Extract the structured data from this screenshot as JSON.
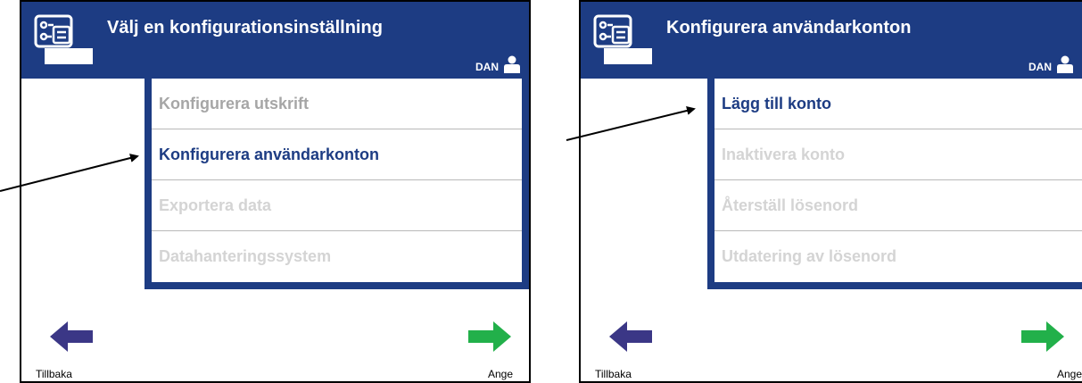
{
  "screens": [
    {
      "title": "Välj en konfigurationsinställning",
      "user": "DAN",
      "items": [
        {
          "label": "Konfigurera utskrift"
        },
        {
          "label": "Konfigurera användarkonton"
        },
        {
          "label": "Exportera data"
        },
        {
          "label": "Datahanteringssystem"
        }
      ],
      "back_label": "Tillbaka",
      "enter_label": "Ange"
    },
    {
      "title": "Konfigurera användarkonton",
      "user": "DAN",
      "items": [
        {
          "label": "Lägg till konto"
        },
        {
          "label": "Inaktivera konto"
        },
        {
          "label": "Återställ lösenord"
        },
        {
          "label": "Utdatering av lösenord"
        }
      ],
      "back_label": "Tillbaka",
      "enter_label": "Ange"
    }
  ],
  "icons": {
    "config": "config-icon",
    "user": "user-icon",
    "back": "back-arrow-icon",
    "enter": "enter-arrow-icon"
  },
  "colors": {
    "header": "#1d3c83",
    "active": "#1d3c83",
    "back_arrow": "#3b3786",
    "enter_arrow": "#22b04a"
  }
}
